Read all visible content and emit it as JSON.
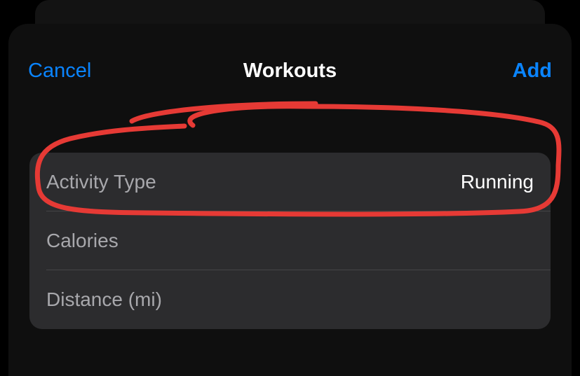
{
  "nav": {
    "cancel_label": "Cancel",
    "title": "Workouts",
    "add_label": "Add"
  },
  "rows": [
    {
      "label": "Activity Type",
      "value": "Running"
    },
    {
      "label": "Calories",
      "value": ""
    },
    {
      "label": "Distance (mi)",
      "value": ""
    }
  ],
  "annotation": {
    "stroke": "#e63a35"
  }
}
